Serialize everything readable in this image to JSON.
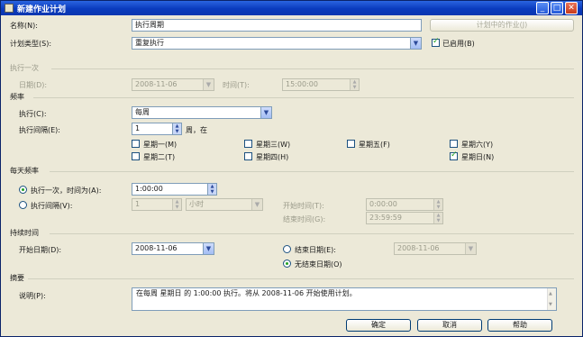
{
  "window": {
    "title": "新建作业计划",
    "minimize_glyph": "_",
    "maximize_glyph": "□",
    "close_glyph": "✕"
  },
  "header": {
    "name_label": "名称(N):",
    "name_value": "执行周期",
    "jobs_button": "计划中的作业(J)",
    "type_label": "计划类型(S):",
    "type_value": "重复执行",
    "enabled_label": "已启用(B)",
    "enabled": true
  },
  "one_time": {
    "title": "执行一次",
    "date_label": "日期(D):",
    "date_value": "2008-11-06",
    "time_label": "时间(T):",
    "time_value": "15:00:00"
  },
  "frequency": {
    "title": "频率",
    "occurs_label": "执行(C):",
    "occurs_value": "每周",
    "recurs_label": "执行间隔(E):",
    "recurs_value": "1",
    "recurs_unit": "周，在",
    "days": [
      {
        "label": "星期一(M)",
        "checked": false
      },
      {
        "label": "星期三(W)",
        "checked": false
      },
      {
        "label": "星期五(F)",
        "checked": false
      },
      {
        "label": "星期六(Y)",
        "checked": false
      },
      {
        "label": "星期二(T)",
        "checked": false
      },
      {
        "label": "星期四(H)",
        "checked": false
      },
      {
        "label": "星期日(N)",
        "checked": true
      }
    ]
  },
  "daily": {
    "title": "每天频率",
    "once_label": "执行一次，时间为(A):",
    "once_value": "1:00:00",
    "every_label": "执行间隔(V):",
    "every_value": "1",
    "every_unit": "小时",
    "start_label": "开始时间(T):",
    "start_value": "0:00:00",
    "end_label": "结束时间(G):",
    "end_value": "23:59:59"
  },
  "duration": {
    "title": "持续时间",
    "start_label": "开始日期(D):",
    "start_value": "2008-11-06",
    "end_label": "结束日期(E):",
    "end_value": "2008-11-06",
    "no_end_label": "无结束日期(O)"
  },
  "summary": {
    "title": "摘要",
    "desc_label": "说明(P):",
    "desc_value": "在每周 星期日 的 1:00:00 执行。将从 2008-11-06 开始使用计划。"
  },
  "footer": {
    "ok": "确定",
    "cancel": "取消",
    "help": "帮助"
  }
}
